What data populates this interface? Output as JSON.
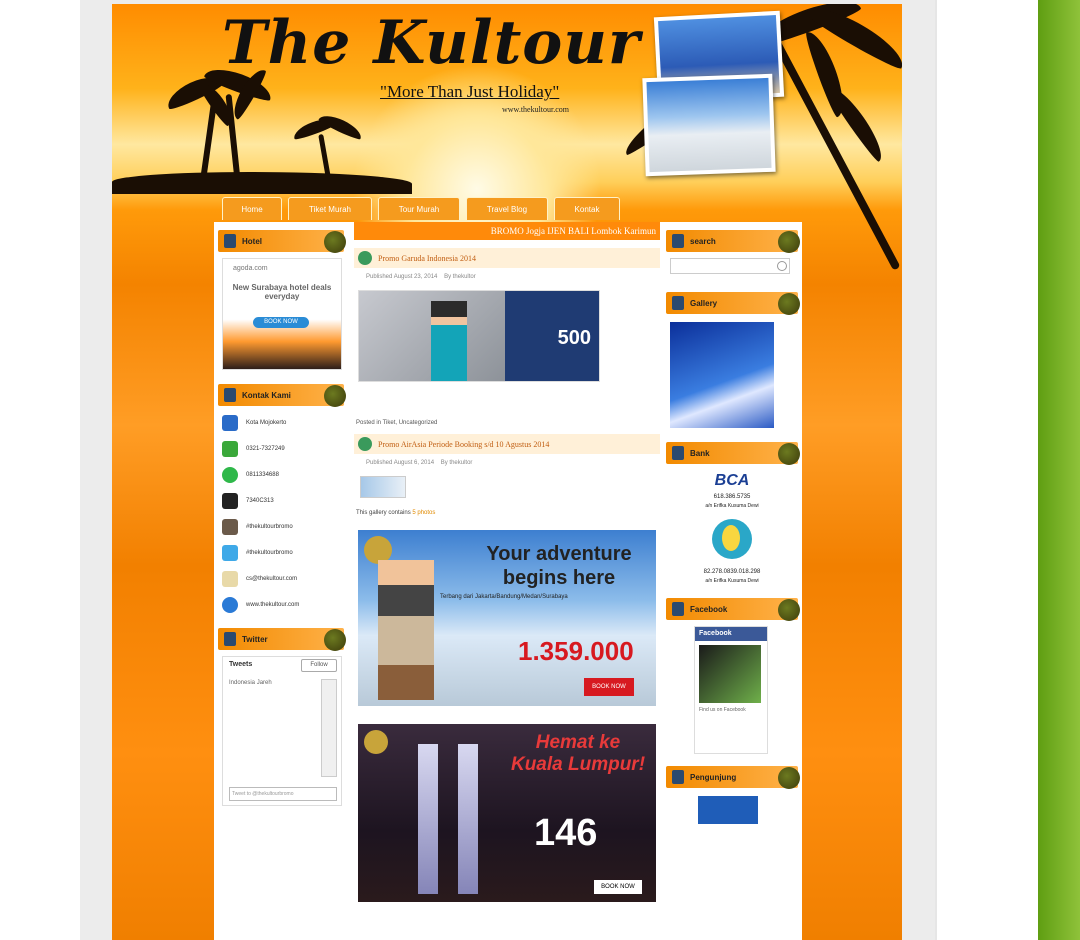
{
  "site": {
    "title": "The Kultour",
    "tagline": "\"More Than Just Holiday\"",
    "url": "www.thekultour.com"
  },
  "nav": {
    "items": [
      "Home",
      "Tiket Murah",
      "Tour Murah",
      "Travel Blog",
      "Kontak"
    ]
  },
  "left": {
    "hotel_title": "Hotel",
    "ad": {
      "brand": "agoda.com",
      "headline": "New Surabaya hotel deals everyday",
      "button": "BOOK NOW"
    },
    "kontak_title": "Kontak Kami",
    "contacts": [
      {
        "icon": "home-icon",
        "text": "Kota Mojokerto"
      },
      {
        "icon": "phone-icon",
        "text": "0321-7327249"
      },
      {
        "icon": "whatsapp-icon",
        "text": "0811334688"
      },
      {
        "icon": "bbm-icon",
        "text": "7340C313"
      },
      {
        "icon": "instagram-icon",
        "text": "#thekultourbromo"
      },
      {
        "icon": "twitter-icon",
        "text": "#thekultourbromo"
      },
      {
        "icon": "mail-icon",
        "text": "cs@thekultour.com"
      },
      {
        "icon": "web-icon",
        "text": "www.thekultour.com"
      }
    ],
    "twitter_title": "Twitter",
    "twitter": {
      "header": "Tweets",
      "follow": "Follow",
      "account": "Indonesia Jareh",
      "tweet": "Tweet to @thekultourbromo"
    }
  },
  "main": {
    "marquee": "BROMO Jogja IJEN BALI Lombok Karimun",
    "posts": [
      {
        "title": "Promo Garuda Indonesia 2014",
        "meta": "Published August 23, 2014",
        "author": "By thekultor",
        "promo_value": "500",
        "footer": "Posted in Tiket, Uncategorized"
      },
      {
        "title": "Promo AirAsia Periode Booking s/d 10 Agustus 2014",
        "meta": "Published August 6, 2014",
        "author": "By thekultor",
        "gallery_text": "This gallery contains",
        "gallery_link": "5 photos"
      }
    ],
    "ad1": {
      "headline": "Your adventure begins here",
      "sub": "Terbang dari Jakarta/Bandung/Medan/Surabaya",
      "price": "1.359.000",
      "book": "BOOK NOW"
    },
    "ad2": {
      "headline": "Hemat ke Kuala Lumpur!",
      "price": "146",
      "book": "BOOK NOW"
    }
  },
  "right": {
    "search_title": "search",
    "gallery_title": "Gallery",
    "bank_title": "Bank",
    "banks": [
      {
        "name": "BCA",
        "number": "618.386.5735",
        "holder": "a/n Erifka Kusuma Dewi"
      },
      {
        "name": "Mandiri",
        "number": "82.278.0839.018.298",
        "holder": "a/n Erifka Kusuma Dewi"
      }
    ],
    "facebook_title": "Facebook",
    "facebook": {
      "label": "Facebook",
      "caption": "Find us on Facebook"
    },
    "pengunjung_title": "Pengunjung"
  }
}
